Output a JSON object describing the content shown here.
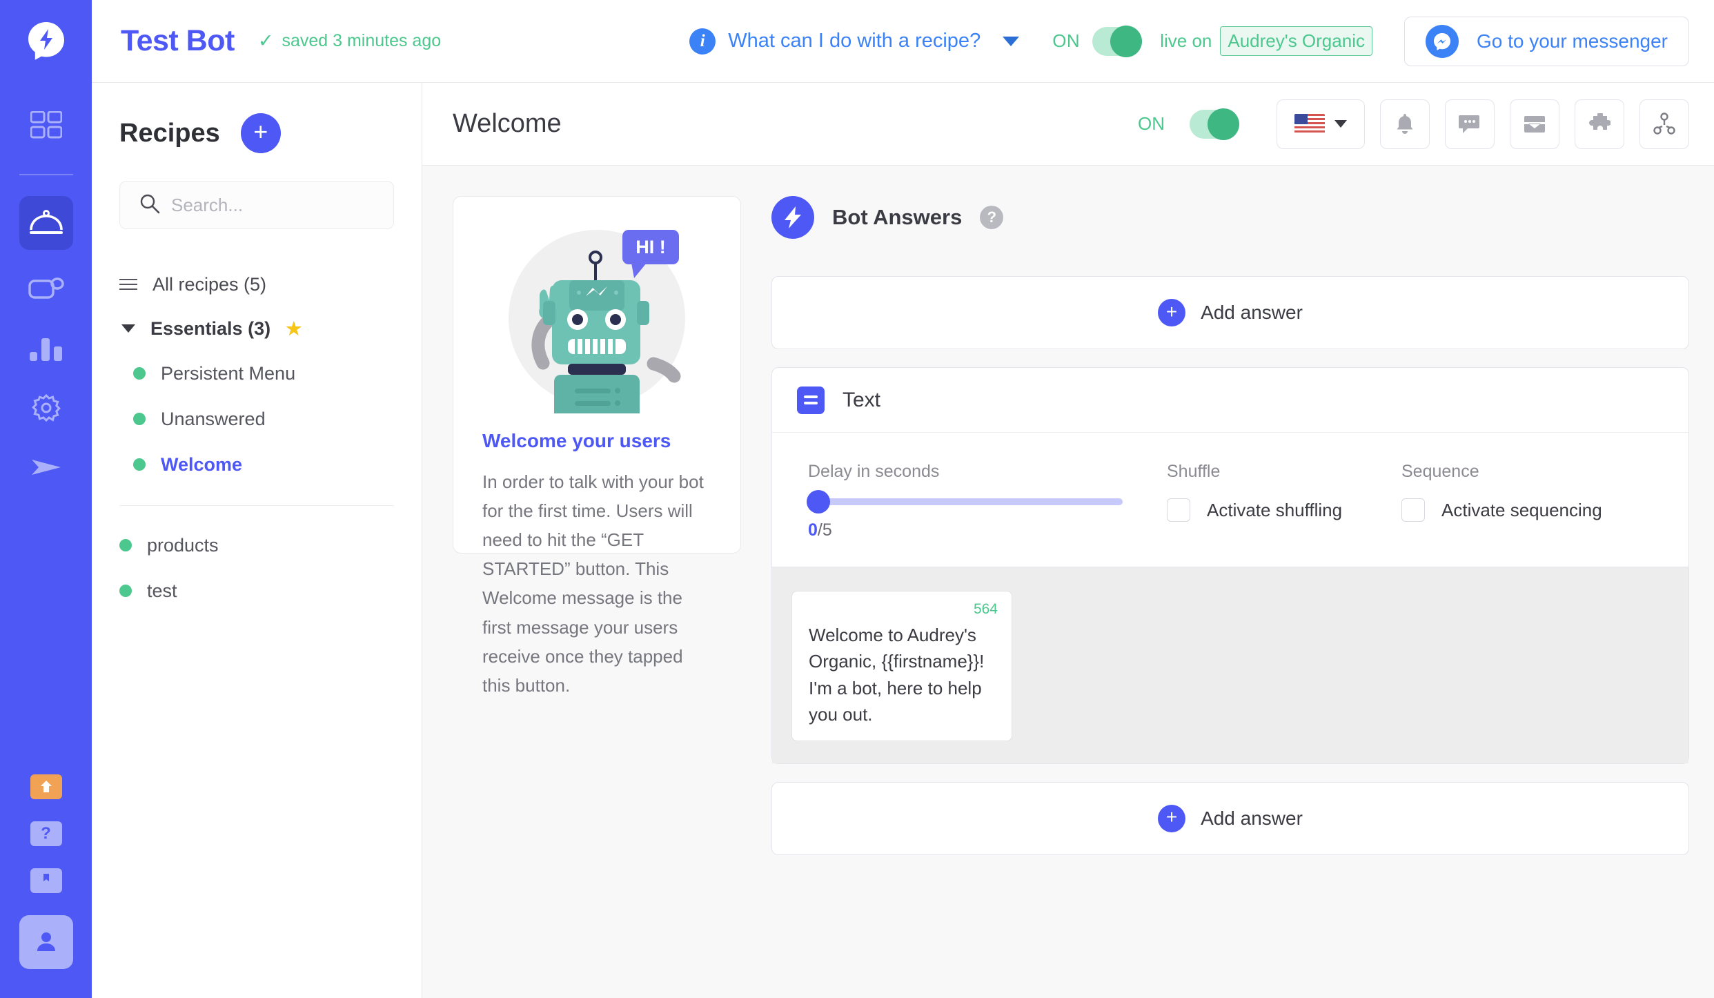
{
  "topbar": {
    "bot_name": "Test Bot",
    "saved_status": "saved 3 minutes ago",
    "saved_check_glyph": "✓",
    "recipe_hint": "What can I do with a recipe?",
    "on_label": "ON",
    "live_prefix": "live on",
    "page_name": "Audrey's Organic",
    "messenger_button": "Go to your messenger"
  },
  "rail": {
    "items": [
      {
        "name": "dashboard-icon"
      },
      {
        "name": "recipes-icon",
        "active": true
      },
      {
        "name": "broadcast-icon"
      },
      {
        "name": "analytics-icon"
      },
      {
        "name": "settings-icon"
      },
      {
        "name": "send-icon"
      },
      {
        "name": "upgrade-icon"
      },
      {
        "name": "help-icon"
      },
      {
        "name": "docs-icon"
      },
      {
        "name": "account-icon"
      }
    ]
  },
  "recipes": {
    "title": "Recipes",
    "add_button_glyph": "+",
    "search_placeholder": "Search...",
    "search_value": "",
    "all_recipes": "All recipes (5)",
    "group": {
      "label": "Essentials (3)",
      "star_glyph": "★",
      "items": [
        {
          "label": "Persistent Menu",
          "active": false
        },
        {
          "label": "Unanswered",
          "active": false
        },
        {
          "label": "Welcome",
          "active": true
        }
      ]
    },
    "other_items": [
      {
        "label": "products"
      },
      {
        "label": "test"
      }
    ]
  },
  "main": {
    "title": "Welcome",
    "on_label": "ON",
    "language": "US",
    "toolbar_icons": [
      "bell-icon",
      "chat-bubble-icon",
      "inbox-icon",
      "puzzle-icon",
      "share-icon"
    ],
    "info_card": {
      "illustration": "robot-waving-illustration",
      "speech_bubble": "HI !",
      "title": "Welcome your users",
      "body": "In order to talk with your bot for the first time. Users will need to hit the “GET STARTED” button. This Welcome message is the first message your users receive once they tapped this button."
    },
    "answers": {
      "title": "Bot Answers",
      "help_glyph": "?",
      "add_answer_top": "Add answer",
      "add_answer_bottom": "Add answer",
      "plus_glyph": "+",
      "text_block": {
        "title": "Text",
        "delay_label": "Delay in seconds",
        "delay_value": "0",
        "delay_max": "5",
        "delay_display_suffix": "/5",
        "shuffle_label": "Shuffle",
        "shuffle_checkbox": "Activate shuffling",
        "shuffle_checked": false,
        "sequence_label": "Sequence",
        "sequence_checkbox": "Activate sequencing",
        "sequence_checked": false,
        "message_value": "Welcome to Audrey's Organic, {{firstname}}! I'm a bot, here to help you out.",
        "char_count": "564"
      }
    }
  },
  "colors": {
    "brand_blue": "#4d58f5",
    "green": "#4cc78e",
    "link_blue": "#3b82f6"
  }
}
